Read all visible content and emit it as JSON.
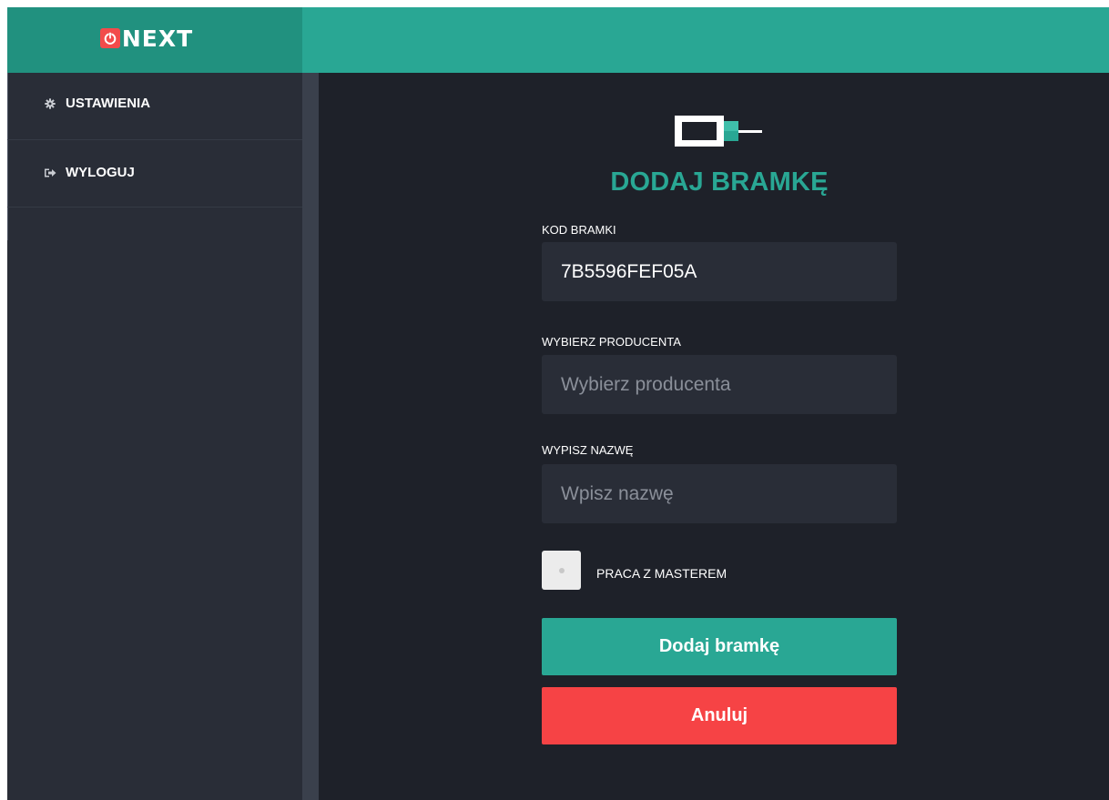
{
  "brand": {
    "logo_icon": "power-icon",
    "name": "NEXT",
    "colors": {
      "logo_bg": "#f24b4b",
      "brand_bg": "#21917f",
      "topbar_bg": "#29a794"
    }
  },
  "sidebar": {
    "items": [
      {
        "label": "USTAWIENIA",
        "icon": "gear-icon"
      },
      {
        "label": "WYLOGUJ",
        "icon": "logout-icon"
      }
    ]
  },
  "form": {
    "title": "DODAJ BRAMKĘ",
    "icon": "gateway-device-icon",
    "code": {
      "label": "KOD BRAMKI",
      "value": "7B5596FEF05A"
    },
    "producer": {
      "label": "WYBIERZ PRODUCENTA",
      "placeholder": "Wybierz producenta"
    },
    "name": {
      "label": "WYPISZ NAZWĘ",
      "placeholder": "Wpisz nazwę"
    },
    "master": {
      "label": "PRACA Z MASTEREM",
      "checked": false
    },
    "submit_label": "Dodaj bramkę",
    "cancel_label": "Anuluj"
  },
  "colors": {
    "accent": "#29a794",
    "danger": "#f64345",
    "background": "#1e2129",
    "panel": "#292d37"
  }
}
